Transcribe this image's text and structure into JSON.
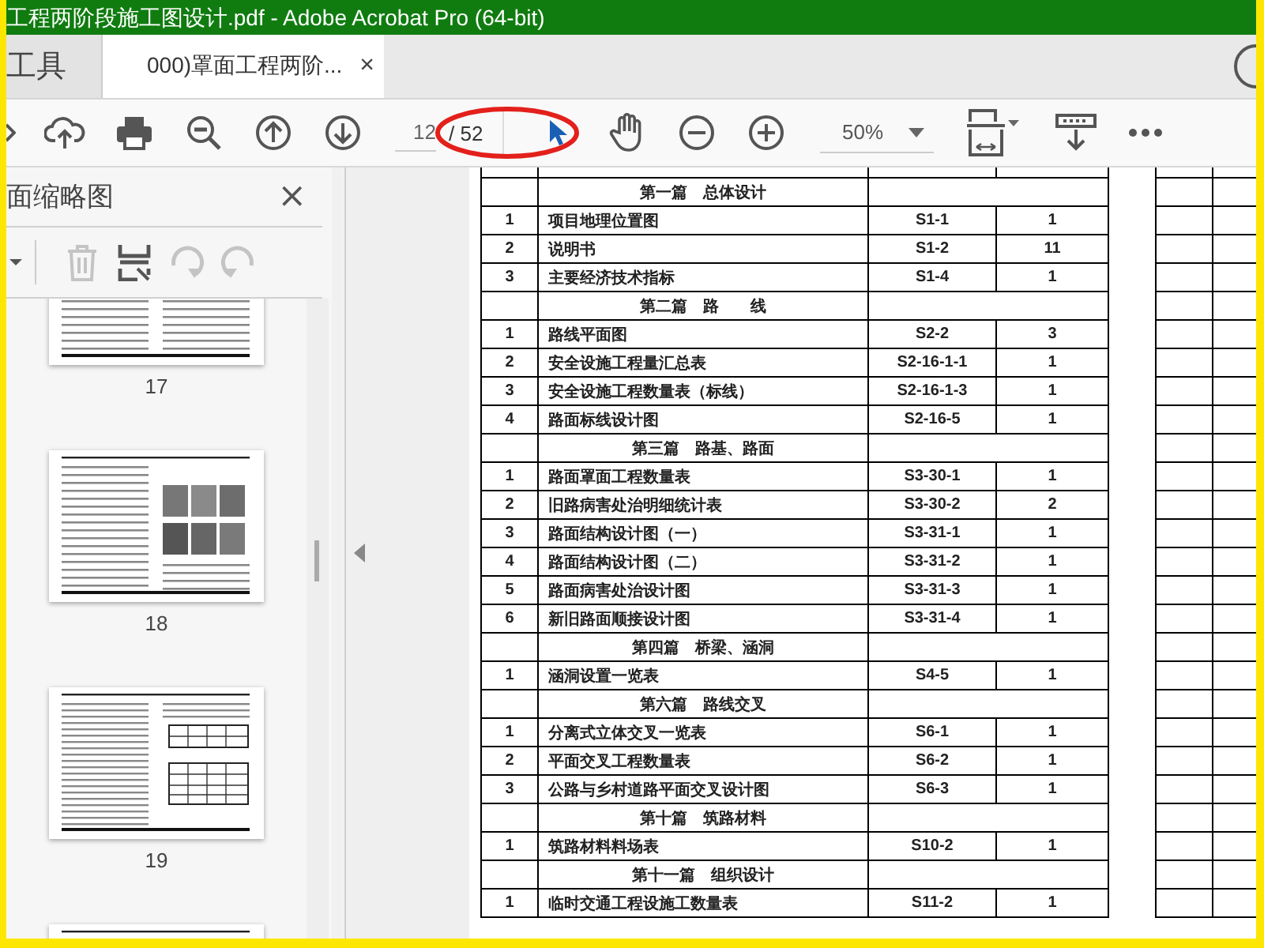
{
  "window": {
    "title": "工程两阶段施工图设计.pdf - Adobe Acrobat Pro (64-bit)"
  },
  "tabs": [
    {
      "label": "工具",
      "kind": "tools",
      "selected": false
    },
    {
      "label": "000)罩面工程两阶...",
      "kind": "document",
      "selected": true,
      "close": "×"
    }
  ],
  "toolbar": {
    "page_number": "12",
    "page_total": "/ 52",
    "zoom": "50%"
  },
  "markup": {
    "kind": "ellipse"
  },
  "thumbnails_panel": {
    "title": "面缩略图",
    "close": "×",
    "tools": [
      {
        "kind": "page-options",
        "disabled": false
      },
      {
        "kind": "trash",
        "disabled": true
      },
      {
        "kind": "extract",
        "disabled": false
      },
      {
        "kind": "rotate-left",
        "disabled": true
      },
      {
        "kind": "rotate-right",
        "disabled": true
      }
    ],
    "pages": [
      {
        "label": "17",
        "kind": "text"
      },
      {
        "label": "18",
        "kind": "photos"
      },
      {
        "label": "19",
        "kind": "tables"
      },
      {
        "kind": "text"
      }
    ]
  },
  "document": {
    "rows": [
      {
        "kind": "blank"
      },
      {
        "kind": "section",
        "title": "第一篇　总体设计"
      },
      {
        "kind": "item",
        "no": "1",
        "name": "项目地理位置图",
        "code": "S1-1",
        "sheets": "1"
      },
      {
        "kind": "item",
        "no": "2",
        "name": "说明书",
        "code": "S1-2",
        "sheets": "11"
      },
      {
        "kind": "item",
        "no": "3",
        "name": "主要经济技术指标",
        "code": "S1-4",
        "sheets": "1"
      },
      {
        "kind": "section",
        "title": "第二篇　路　　线"
      },
      {
        "kind": "item",
        "no": "1",
        "name": "路线平面图",
        "code": "S2-2",
        "sheets": "3"
      },
      {
        "kind": "item",
        "no": "2",
        "name": "安全设施工程量汇总表",
        "code": "S2-16-1-1",
        "sheets": "1"
      },
      {
        "kind": "item",
        "no": "3",
        "name": "安全设施工程数量表（标线）",
        "code": "S2-16-1-3",
        "sheets": "1"
      },
      {
        "kind": "item",
        "no": "4",
        "name": "路面标线设计图",
        "code": "S2-16-5",
        "sheets": "1"
      },
      {
        "kind": "section",
        "title": "第三篇　路基、路面"
      },
      {
        "kind": "item",
        "no": "1",
        "name": "路面罩面工程数量表",
        "code": "S3-30-1",
        "sheets": "1"
      },
      {
        "kind": "item",
        "no": "2",
        "name": "旧路病害处治明细统计表",
        "code": "S3-30-2",
        "sheets": "2"
      },
      {
        "kind": "item",
        "no": "3",
        "name": "路面结构设计图（一）",
        "code": "S3-31-1",
        "sheets": "1"
      },
      {
        "kind": "item",
        "no": "4",
        "name": "路面结构设计图（二）",
        "code": "S3-31-2",
        "sheets": "1"
      },
      {
        "kind": "item",
        "no": "5",
        "name": "路面病害处治设计图",
        "code": "S3-31-3",
        "sheets": "1"
      },
      {
        "kind": "item",
        "no": "6",
        "name": "新旧路面顺接设计图",
        "code": "S3-31-4",
        "sheets": "1"
      },
      {
        "kind": "section",
        "title": "第四篇　桥梁、涵洞"
      },
      {
        "kind": "item",
        "no": "1",
        "name": "涵洞设置一览表",
        "code": "S4-5",
        "sheets": "1"
      },
      {
        "kind": "section",
        "title": "第六篇　路线交叉"
      },
      {
        "kind": "item",
        "no": "1",
        "name": "分离式立体交叉一览表",
        "code": "S6-1",
        "sheets": "1"
      },
      {
        "kind": "item",
        "no": "2",
        "name": "平面交叉工程数量表",
        "code": "S6-2",
        "sheets": "1"
      },
      {
        "kind": "item",
        "no": "3",
        "name": "公路与乡村道路平面交叉设计图",
        "code": "S6-3",
        "sheets": "1"
      },
      {
        "kind": "section",
        "title": "第十篇　筑路材料"
      },
      {
        "kind": "item",
        "no": "1",
        "name": "筑路材料料场表",
        "code": "S10-2",
        "sheets": "1"
      },
      {
        "kind": "section",
        "title": "第十一篇　组织设计"
      },
      {
        "kind": "item",
        "no": "1",
        "name": "临时交通工程设施工数量表",
        "code": "S11-2",
        "sheets": "1"
      }
    ]
  }
}
